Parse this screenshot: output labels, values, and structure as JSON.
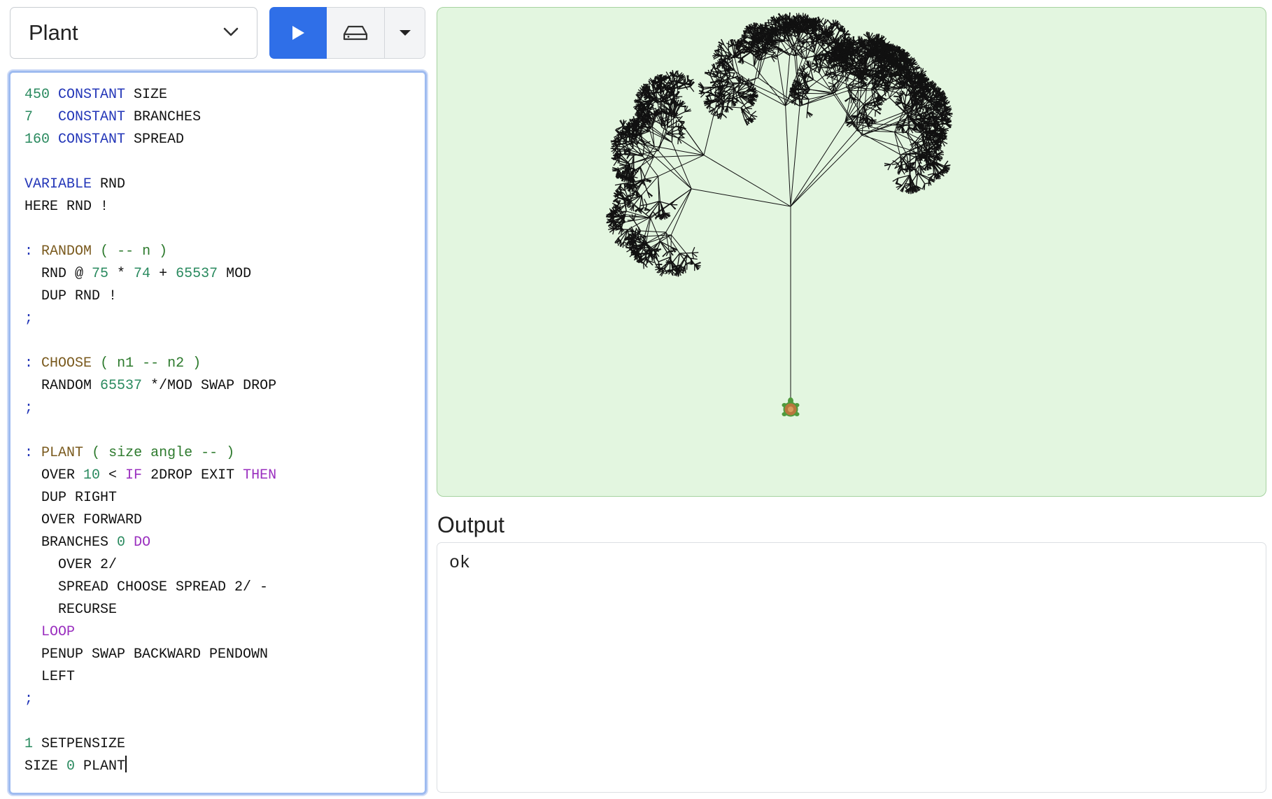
{
  "toolbar": {
    "example_select": {
      "selected": "Plant"
    },
    "icons": {
      "run": "play-icon",
      "save": "drive-icon",
      "menu": "caret-down-icon"
    }
  },
  "editor": {
    "lines": [
      "450 CONSTANT SIZE",
      "7   CONSTANT BRANCHES",
      "160 CONSTANT SPREAD",
      "",
      "VARIABLE RND",
      "HERE RND !",
      "",
      ": RANDOM ( -- n )",
      "  RND @ 75 * 74 + 65537 MOD",
      "  DUP RND !",
      ";",
      "",
      ": CHOOSE ( n1 -- n2 )",
      "  RANDOM 65537 */MOD SWAP DROP",
      ";",
      "",
      ": PLANT ( size angle -- )",
      "  OVER 10 < IF 2DROP EXIT THEN",
      "  DUP RIGHT",
      "  OVER FORWARD",
      "  BRANCHES 0 DO",
      "    OVER 2/",
      "    SPREAD CHOOSE SPREAD 2/ -",
      "    RECURSE",
      "  LOOP",
      "  PENUP SWAP BACKWARD PENDOWN",
      "  LEFT",
      ";",
      "",
      "1 SETPENSIZE",
      "SIZE 0 PLANT"
    ]
  },
  "canvas": {
    "background": "#e3f6e0",
    "turtle_icon": "turtle-icon"
  },
  "output": {
    "title": "Output",
    "text": "ok"
  },
  "colors": {
    "accent": "#2f6fe8",
    "number": "#2a8a5f",
    "keyword": "#2336b8",
    "definition": "#7a5a1e",
    "comment": "#2d7a2d",
    "control": "#9a2fbf"
  }
}
